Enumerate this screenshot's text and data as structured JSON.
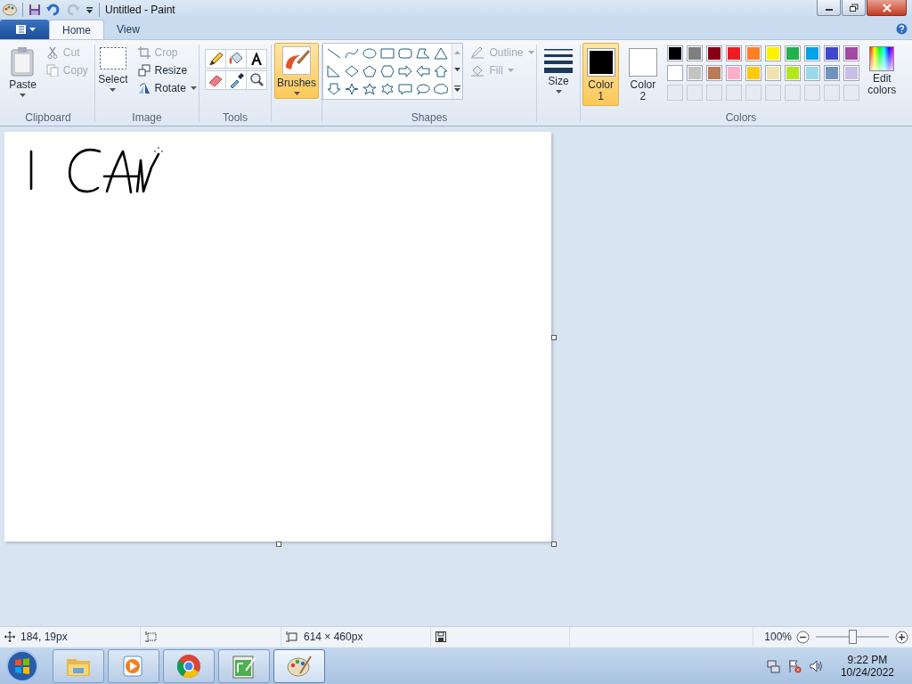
{
  "window": {
    "title": "Untitled - Paint"
  },
  "tabs": [
    {
      "label": "Home",
      "selected": true
    },
    {
      "label": "View",
      "selected": false
    }
  ],
  "clipboard": {
    "label": "Clipboard",
    "paste": "Paste",
    "items": [
      {
        "kind": "cut",
        "label": "Cut",
        "disabled": true
      },
      {
        "kind": "copy",
        "label": "Copy",
        "disabled": true
      }
    ]
  },
  "image": {
    "label": "Image",
    "select": "Select",
    "items": [
      {
        "kind": "crop",
        "label": "Crop",
        "disabled": true
      },
      {
        "kind": "resize",
        "label": "Resize",
        "disabled": false
      },
      {
        "kind": "rotate",
        "label": "Rotate",
        "disabled": false
      }
    ]
  },
  "tools": {
    "label": "Tools"
  },
  "brushes": {
    "label": "Brushes",
    "selected": true
  },
  "shapes": {
    "label": "Shapes",
    "options": [
      {
        "kind": "outline",
        "label": "Outline",
        "disabled": true
      },
      {
        "kind": "fill",
        "label": "Fill",
        "disabled": true
      }
    ]
  },
  "size": {
    "label": "Size"
  },
  "colors": {
    "label": "Colors",
    "slots": [
      {
        "label": "Color 1",
        "color": "#000000",
        "selected": true
      },
      {
        "label": "Color 2",
        "color": "#ffffff",
        "selected": false
      }
    ],
    "palette": [
      {
        "color": "#000000"
      },
      {
        "color": "#7f7f7f"
      },
      {
        "color": "#880015"
      },
      {
        "color": "#ed1c24"
      },
      {
        "color": "#ff7f27"
      },
      {
        "color": "#fff200"
      },
      {
        "color": "#22b14c"
      },
      {
        "color": "#00a2e8"
      },
      {
        "color": "#3f48cc"
      },
      {
        "color": "#a349a4"
      },
      {
        "color": "#ffffff"
      },
      {
        "color": "#c3c3c3"
      },
      {
        "color": "#b97a57"
      },
      {
        "color": "#ffaec9"
      },
      {
        "color": "#ffc90e"
      },
      {
        "color": "#efe4b0"
      },
      {
        "color": "#b5e61d"
      },
      {
        "color": "#99d9ea"
      },
      {
        "color": "#7092be"
      },
      {
        "color": "#c8bfe7"
      }
    ],
    "edit": "Edit colors"
  },
  "status_bar": {
    "position": "184, 19px",
    "canvas_size": "614 × 460px",
    "zoom": "100%",
    "zoom_level": {
      "level": 0.5
    }
  },
  "taskbar": {
    "apps": [
      {
        "kind": "explorer",
        "selected": false
      },
      {
        "kind": "media",
        "selected": false
      },
      {
        "kind": "chrome",
        "selected": false
      },
      {
        "kind": "notepad",
        "selected": false
      },
      {
        "kind": "paint",
        "selected": true
      }
    ],
    "time": "9:22 PM",
    "date": "10/24/2022"
  }
}
